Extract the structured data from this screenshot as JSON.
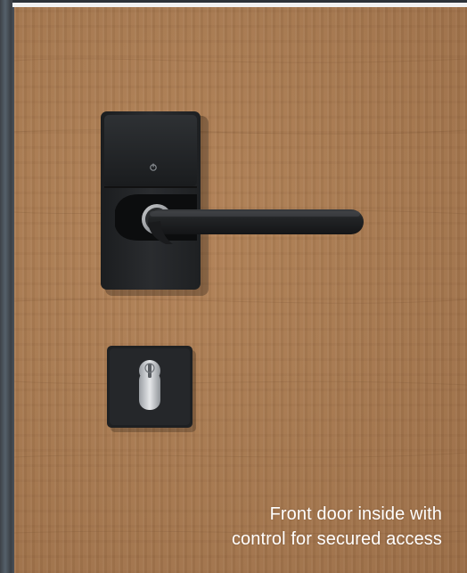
{
  "caption": {
    "line1": "Front door inside with",
    "line2": "control for secured access"
  },
  "icons": {
    "lock_indicator": "power-indicator-icon",
    "keyhole": "keyhole-icon"
  },
  "colors": {
    "wood": "#a87a51",
    "hardware": "#232527",
    "caption_text": "#ffffff"
  }
}
